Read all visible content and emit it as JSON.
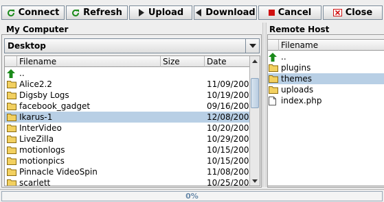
{
  "toolbar": {
    "buttons": [
      {
        "label": "Connect",
        "icon": "refresh-icon"
      },
      {
        "label": "Refresh",
        "icon": "refresh-icon"
      },
      {
        "label": "Upload",
        "icon": "play-right-icon"
      },
      {
        "label": "Download",
        "icon": "play-left-icon"
      },
      {
        "label": "Cancel",
        "icon": "stop-square-icon"
      },
      {
        "label": "Close",
        "icon": "close-box-icon"
      }
    ]
  },
  "colors": {
    "accent_green": "#1a8a1a",
    "cancel_red": "#d01010",
    "selection": "#b8cfe5",
    "folder": "#f2d060"
  },
  "local": {
    "title": "My Computer",
    "location": "Desktop",
    "columns": [
      "Filename",
      "Size",
      "Date"
    ],
    "rows": [
      {
        "name": "..",
        "size": "",
        "date": "",
        "type": "up"
      },
      {
        "name": "Alice2.2",
        "size": "",
        "date": "11/09/200...",
        "type": "folder"
      },
      {
        "name": "Digsby Logs",
        "size": "",
        "date": "10/19/200...",
        "type": "folder"
      },
      {
        "name": "facebook_gadget",
        "size": "",
        "date": "09/16/200...",
        "type": "folder"
      },
      {
        "name": "Ikarus-1",
        "size": "",
        "date": "12/08/200...",
        "type": "folder",
        "selected": true
      },
      {
        "name": "InterVideo",
        "size": "",
        "date": "10/20/200...",
        "type": "folder"
      },
      {
        "name": "LiveZilla",
        "size": "",
        "date": "10/29/200...",
        "type": "folder"
      },
      {
        "name": "motionlogs",
        "size": "",
        "date": "10/15/200...",
        "type": "folder"
      },
      {
        "name": "motionpics",
        "size": "",
        "date": "10/15/200...",
        "type": "folder"
      },
      {
        "name": "Pinnacle VideoSpin",
        "size": "",
        "date": "11/08/200...",
        "type": "folder"
      },
      {
        "name": "scarlett",
        "size": "",
        "date": "10/25/200...",
        "type": "folder"
      }
    ]
  },
  "remote": {
    "title": "Remote Host",
    "columns": [
      "Filename"
    ],
    "rows": [
      {
        "name": "..",
        "type": "up"
      },
      {
        "name": "plugins",
        "type": "folder"
      },
      {
        "name": "themes",
        "type": "folder",
        "selected": true
      },
      {
        "name": "uploads",
        "type": "folder"
      },
      {
        "name": "index.php",
        "type": "file"
      }
    ]
  },
  "status": {
    "progress_text": "0%",
    "progress_fraction": 0
  }
}
